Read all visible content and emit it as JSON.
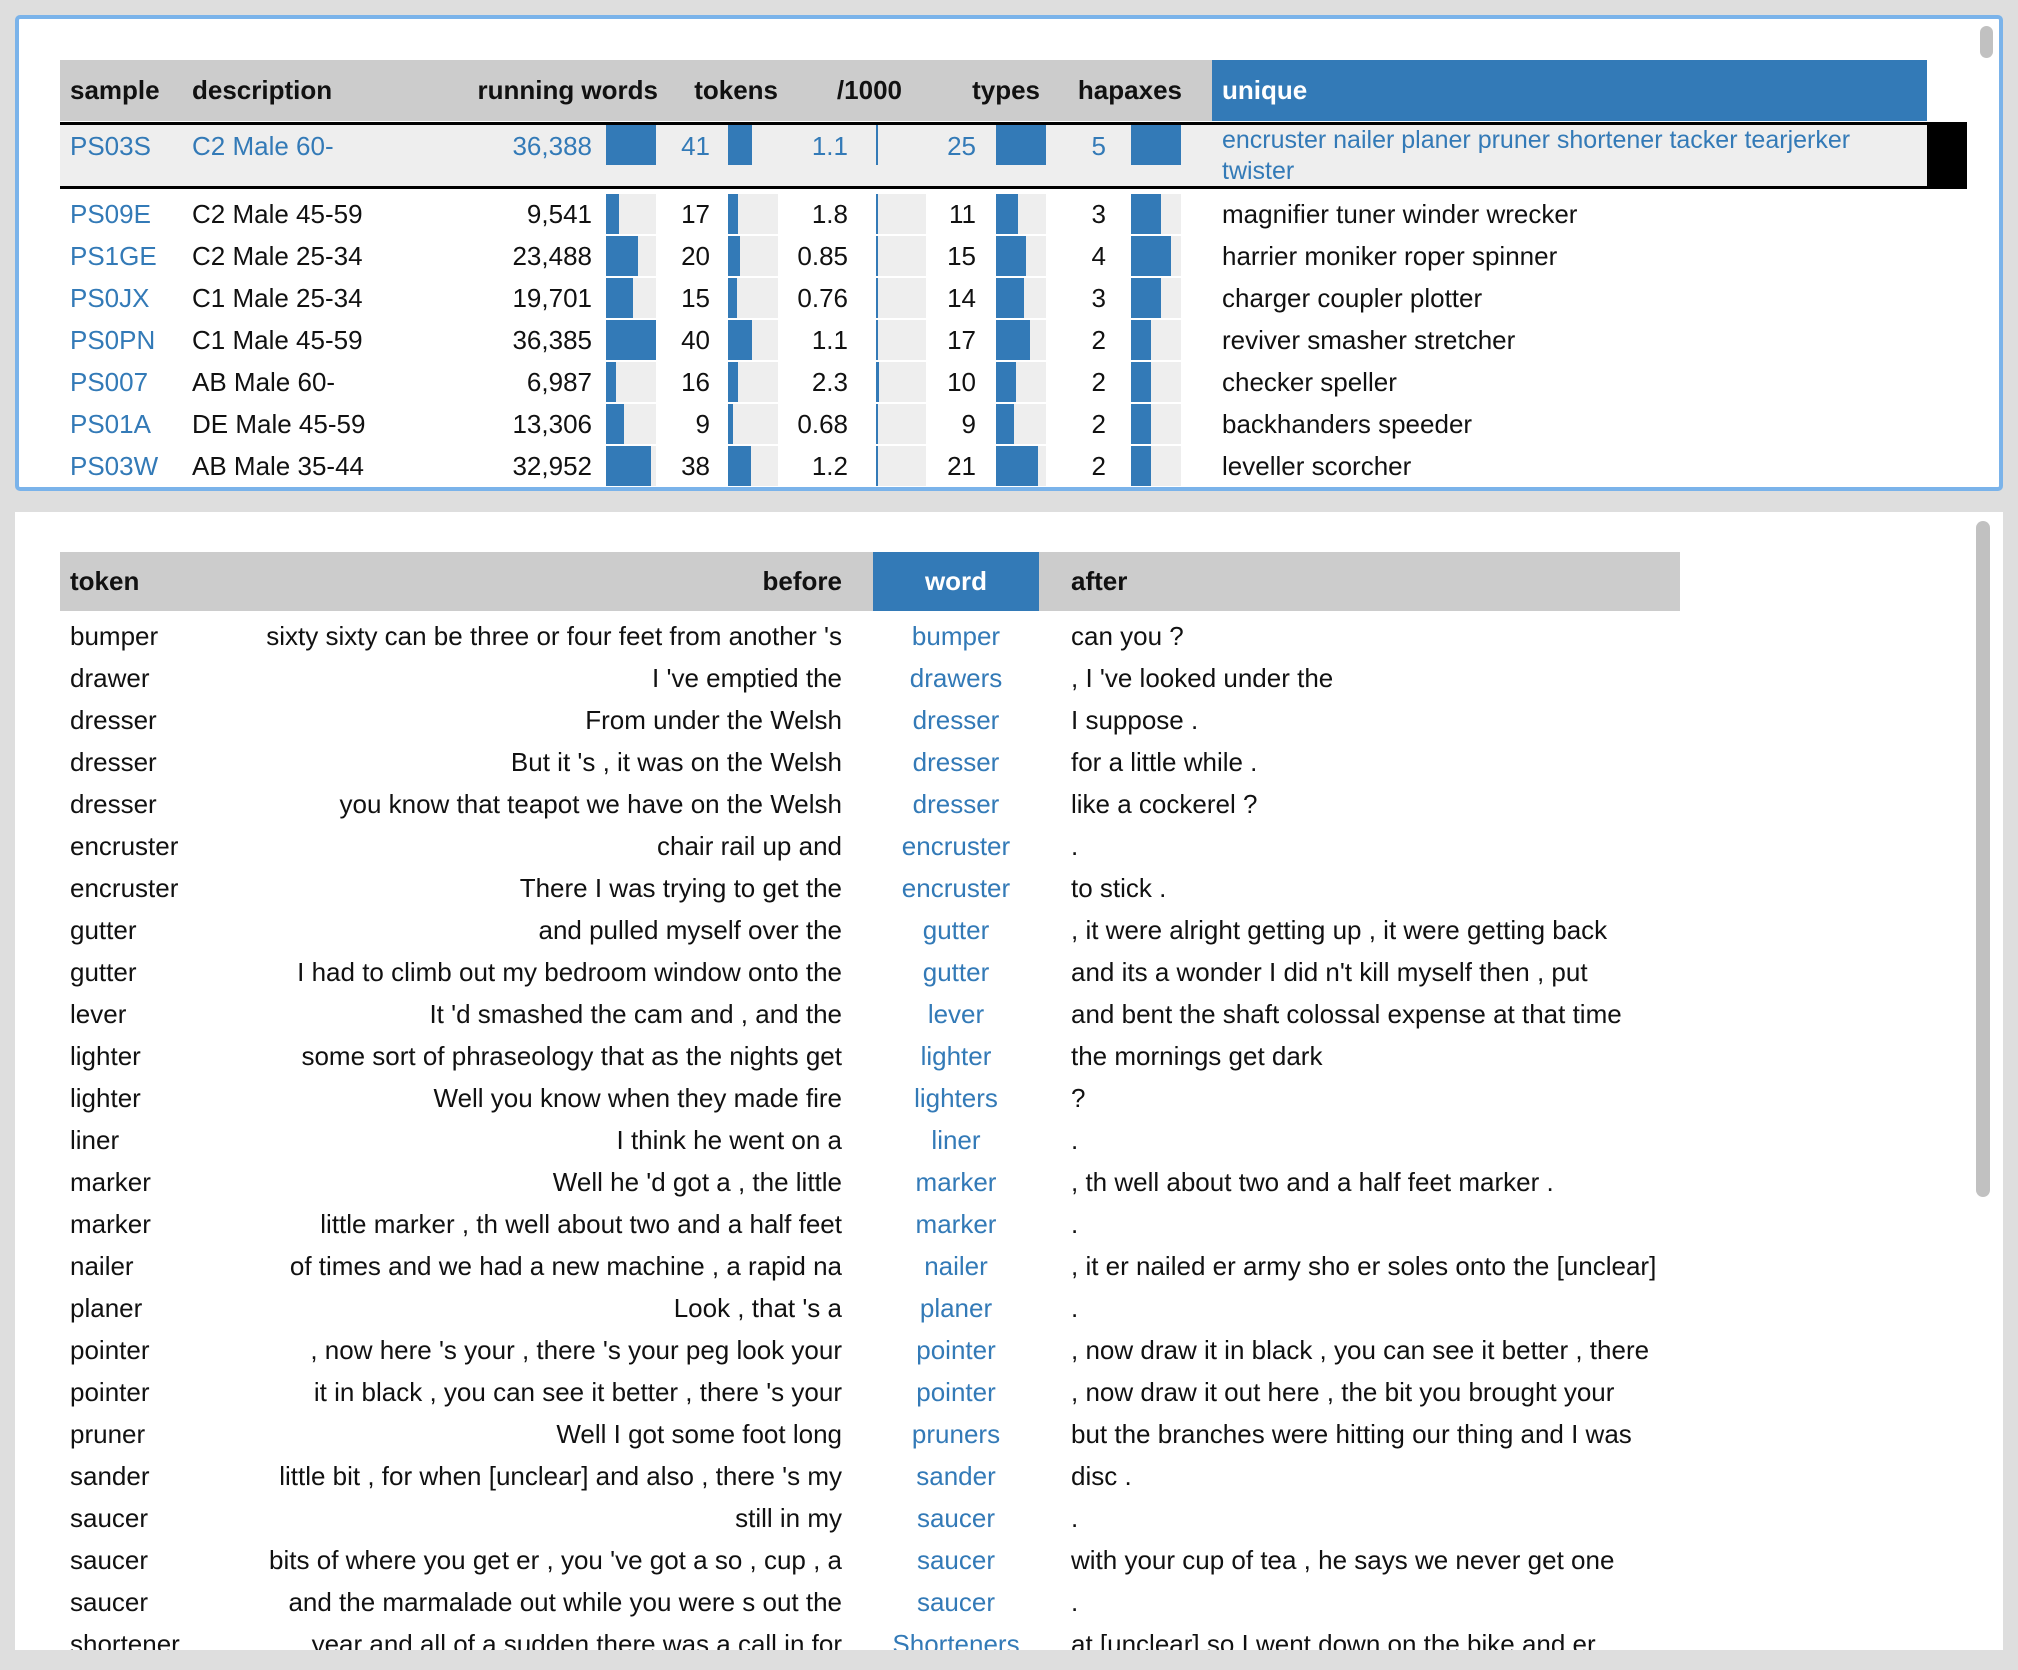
{
  "colors": {
    "accent": "#337ab7",
    "header_bg": "#cccccc",
    "selected_bg": "#eeeeee",
    "focus_border": "#7ab3ea"
  },
  "samples": {
    "columns": [
      "sample",
      "description",
      "running words",
      "tokens",
      "/1000",
      "types",
      "hapaxes",
      "unique"
    ],
    "selected_index": 0,
    "rows": [
      {
        "sample": "PS03S",
        "description": "C2 Male 60-",
        "running_words": "36,388",
        "tokens": "41",
        "per1000": "1.1",
        "types": "25",
        "hapaxes": "5",
        "unique": "encruster nailer planer pruner shortener tacker tearjerker twister"
      },
      {
        "sample": "PS09E",
        "description": "C2 Male 45-59",
        "running_words": "9,541",
        "tokens": "17",
        "per1000": "1.8",
        "types": "11",
        "hapaxes": "3",
        "unique": "magnifier tuner winder wrecker"
      },
      {
        "sample": "PS1GE",
        "description": "C2 Male 25-34",
        "running_words": "23,488",
        "tokens": "20",
        "per1000": "0.85",
        "types": "15",
        "hapaxes": "4",
        "unique": "harrier moniker roper spinner"
      },
      {
        "sample": "PS0JX",
        "description": "C1 Male 25-34",
        "running_words": "19,701",
        "tokens": "15",
        "per1000": "0.76",
        "types": "14",
        "hapaxes": "3",
        "unique": "charger coupler plotter"
      },
      {
        "sample": "PS0PN",
        "description": "C1 Male 45-59",
        "running_words": "36,385",
        "tokens": "40",
        "per1000": "1.1",
        "types": "17",
        "hapaxes": "2",
        "unique": "reviver smasher stretcher"
      },
      {
        "sample": "PS007",
        "description": "AB Male 60-",
        "running_words": "6,987",
        "tokens": "16",
        "per1000": "2.3",
        "types": "10",
        "hapaxes": "2",
        "unique": "checker speller"
      },
      {
        "sample": "PS01A",
        "description": "DE Male 45-59",
        "running_words": "13,306",
        "tokens": "9",
        "per1000": "0.68",
        "types": "9",
        "hapaxes": "2",
        "unique": "backhanders speeder"
      },
      {
        "sample": "PS03W",
        "description": "AB Male 35-44",
        "running_words": "32,952",
        "tokens": "38",
        "per1000": "1.2",
        "types": "21",
        "hapaxes": "2",
        "unique": "leveller scorcher"
      }
    ]
  },
  "concordance": {
    "columns": [
      "token",
      "before",
      "word",
      "after"
    ],
    "rows": [
      {
        "token": "bumper",
        "before": "sixty sixty can be three or four feet from another 's",
        "word": "bumper",
        "after": "can you ?"
      },
      {
        "token": "drawer",
        "before": "I 've emptied the",
        "word": "drawers",
        "after": ", I 've looked under the"
      },
      {
        "token": "dresser",
        "before": "From under the Welsh",
        "word": "dresser",
        "after": "I suppose ."
      },
      {
        "token": "dresser",
        "before": "But it 's , it was on the Welsh",
        "word": "dresser",
        "after": "for a little while ."
      },
      {
        "token": "dresser",
        "before": "you know that teapot we have on the Welsh",
        "word": "dresser",
        "after": "like a cockerel ?"
      },
      {
        "token": "encruster",
        "before": "chair rail up and",
        "word": "encruster",
        "after": "."
      },
      {
        "token": "encruster",
        "before": "There I was trying to get the",
        "word": "encruster",
        "after": "to stick ."
      },
      {
        "token": "gutter",
        "before": "and pulled myself over the",
        "word": "gutter",
        "after": ", it were alright getting up , it were getting back"
      },
      {
        "token": "gutter",
        "before": "I had to climb out my bedroom window onto the",
        "word": "gutter",
        "after": "and its a wonder I did n't kill myself then , put"
      },
      {
        "token": "lever",
        "before": "It 'd smashed the cam and , and the",
        "word": "lever",
        "after": "and bent the shaft colossal expense at that time"
      },
      {
        "token": "lighter",
        "before": "some sort of phraseology that as the nights get",
        "word": "lighter",
        "after": "the mornings get dark"
      },
      {
        "token": "lighter",
        "before": "Well you know when they made fire",
        "word": "lighters",
        "after": "?"
      },
      {
        "token": "liner",
        "before": "I think he went on a",
        "word": "liner",
        "after": "."
      },
      {
        "token": "marker",
        "before": "Well he 'd got a , the little",
        "word": "marker",
        "after": ", th well about two and a half feet marker ."
      },
      {
        "token": "marker",
        "before": "little marker , th well about two and a half feet",
        "word": "marker",
        "after": "."
      },
      {
        "token": "nailer",
        "before": "of times and we had a new machine , a rapid na",
        "word": "nailer",
        "after": ", it er nailed er army sho er soles onto the [unclear]"
      },
      {
        "token": "planer",
        "before": "Look , that 's a",
        "word": "planer",
        "after": "."
      },
      {
        "token": "pointer",
        "before": ", now here 's your , there 's your peg look your",
        "word": "pointer",
        "after": ", now draw it in black , you can see it better , there"
      },
      {
        "token": "pointer",
        "before": "it in black , you can see it better , there 's your",
        "word": "pointer",
        "after": ", now draw it out here , the bit you brought your"
      },
      {
        "token": "pruner",
        "before": "Well I got some foot long",
        "word": "pruners",
        "after": "but the branches were hitting our thing and I was"
      },
      {
        "token": "sander",
        "before": "little bit , for when [unclear] and also , there 's my",
        "word": "sander",
        "after": "disc ."
      },
      {
        "token": "saucer",
        "before": "still in my",
        "word": "saucer",
        "after": "."
      },
      {
        "token": "saucer",
        "before": "bits of where you get er , you 've got a so , cup , a",
        "word": "saucer",
        "after": "with your cup of tea , he says we never get one"
      },
      {
        "token": "saucer",
        "before": "and the marmalade out while you were s out the",
        "word": "saucer",
        "after": "."
      },
      {
        "token": "shortener",
        "before": "year and all of a sudden there was a call in for",
        "word": "Shorteners",
        "after": "at [unclear] so I went down on the bike and er"
      }
    ]
  }
}
